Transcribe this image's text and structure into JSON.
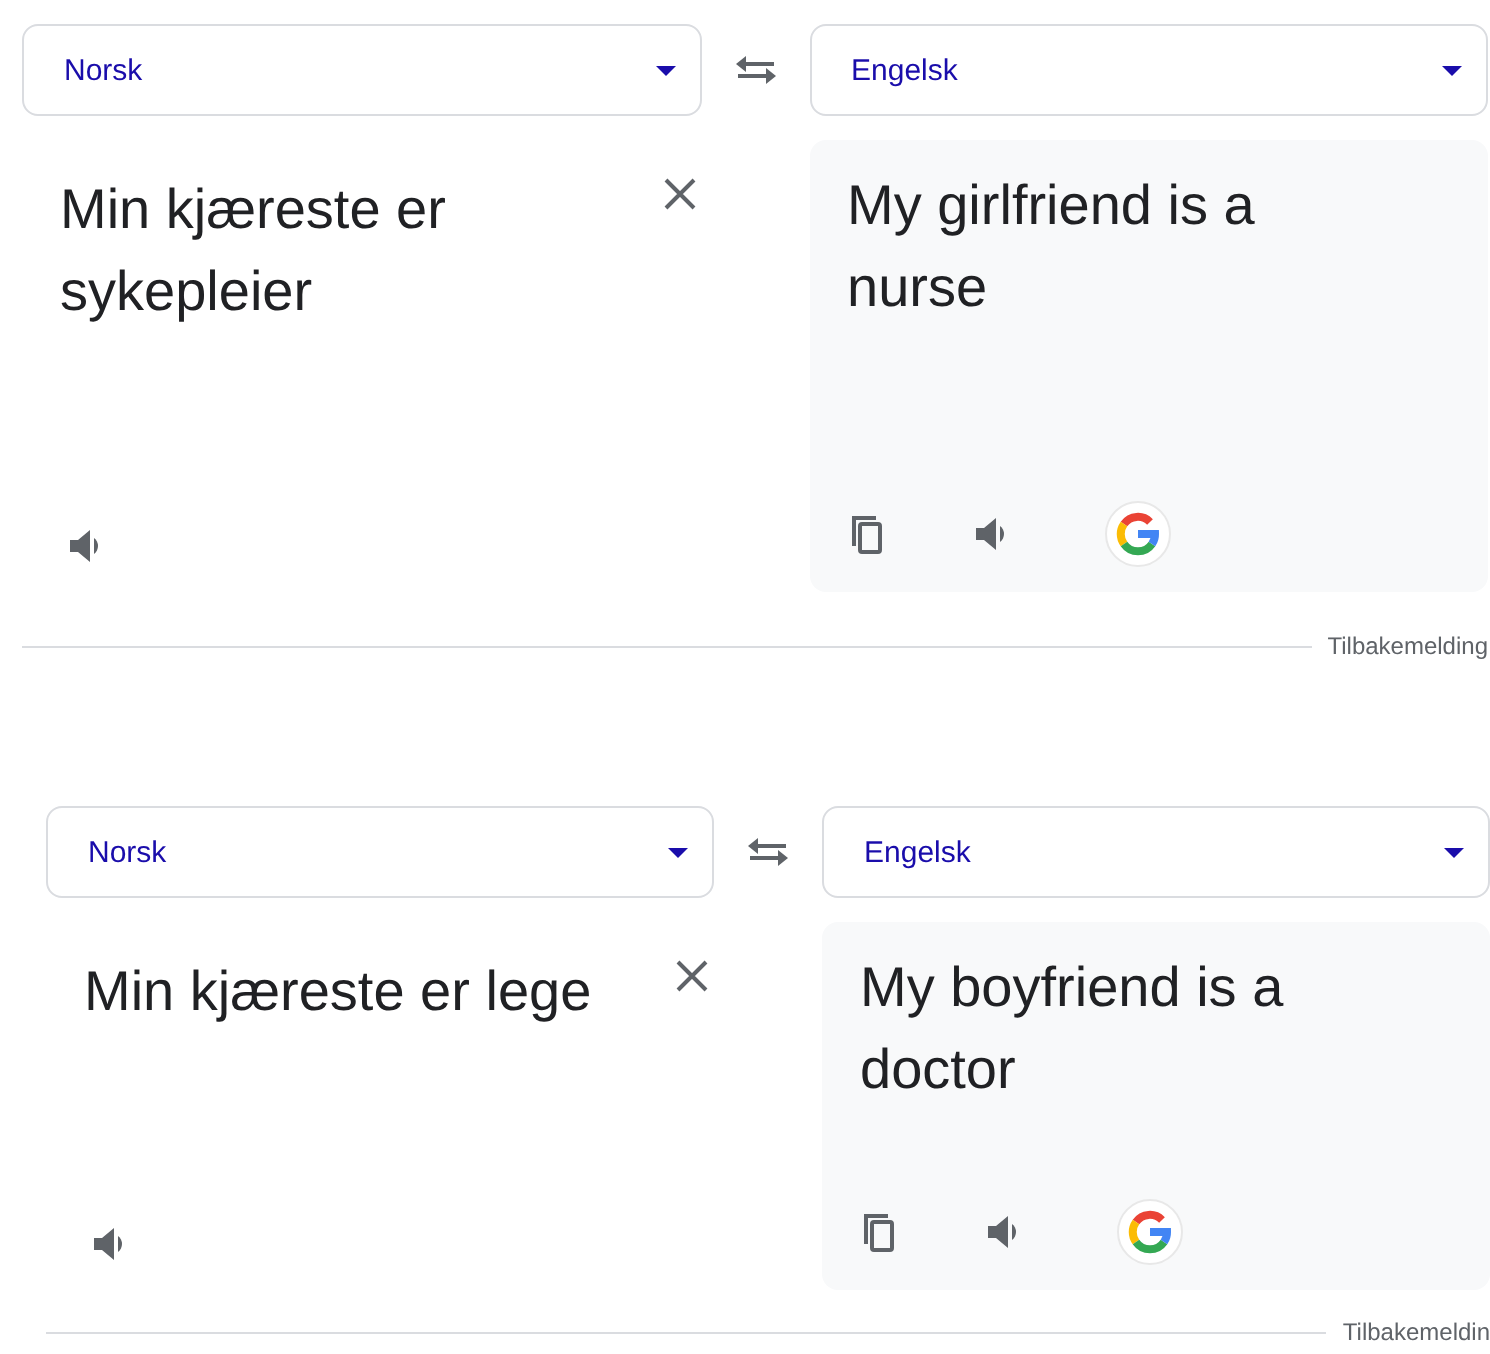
{
  "panels": [
    {
      "source_language": "Norsk",
      "target_language": "Engelsk",
      "source_text": "Min kjæreste er sykepleier",
      "translation": "My girlfriend is a nurse",
      "feedback": "Tilbakemelding"
    },
    {
      "source_language": "Norsk",
      "target_language": "Engelsk",
      "source_text": "Min kjæreste er lege",
      "translation": "My boyfriend is a doctor",
      "feedback": "Tilbakemeldin"
    }
  ]
}
